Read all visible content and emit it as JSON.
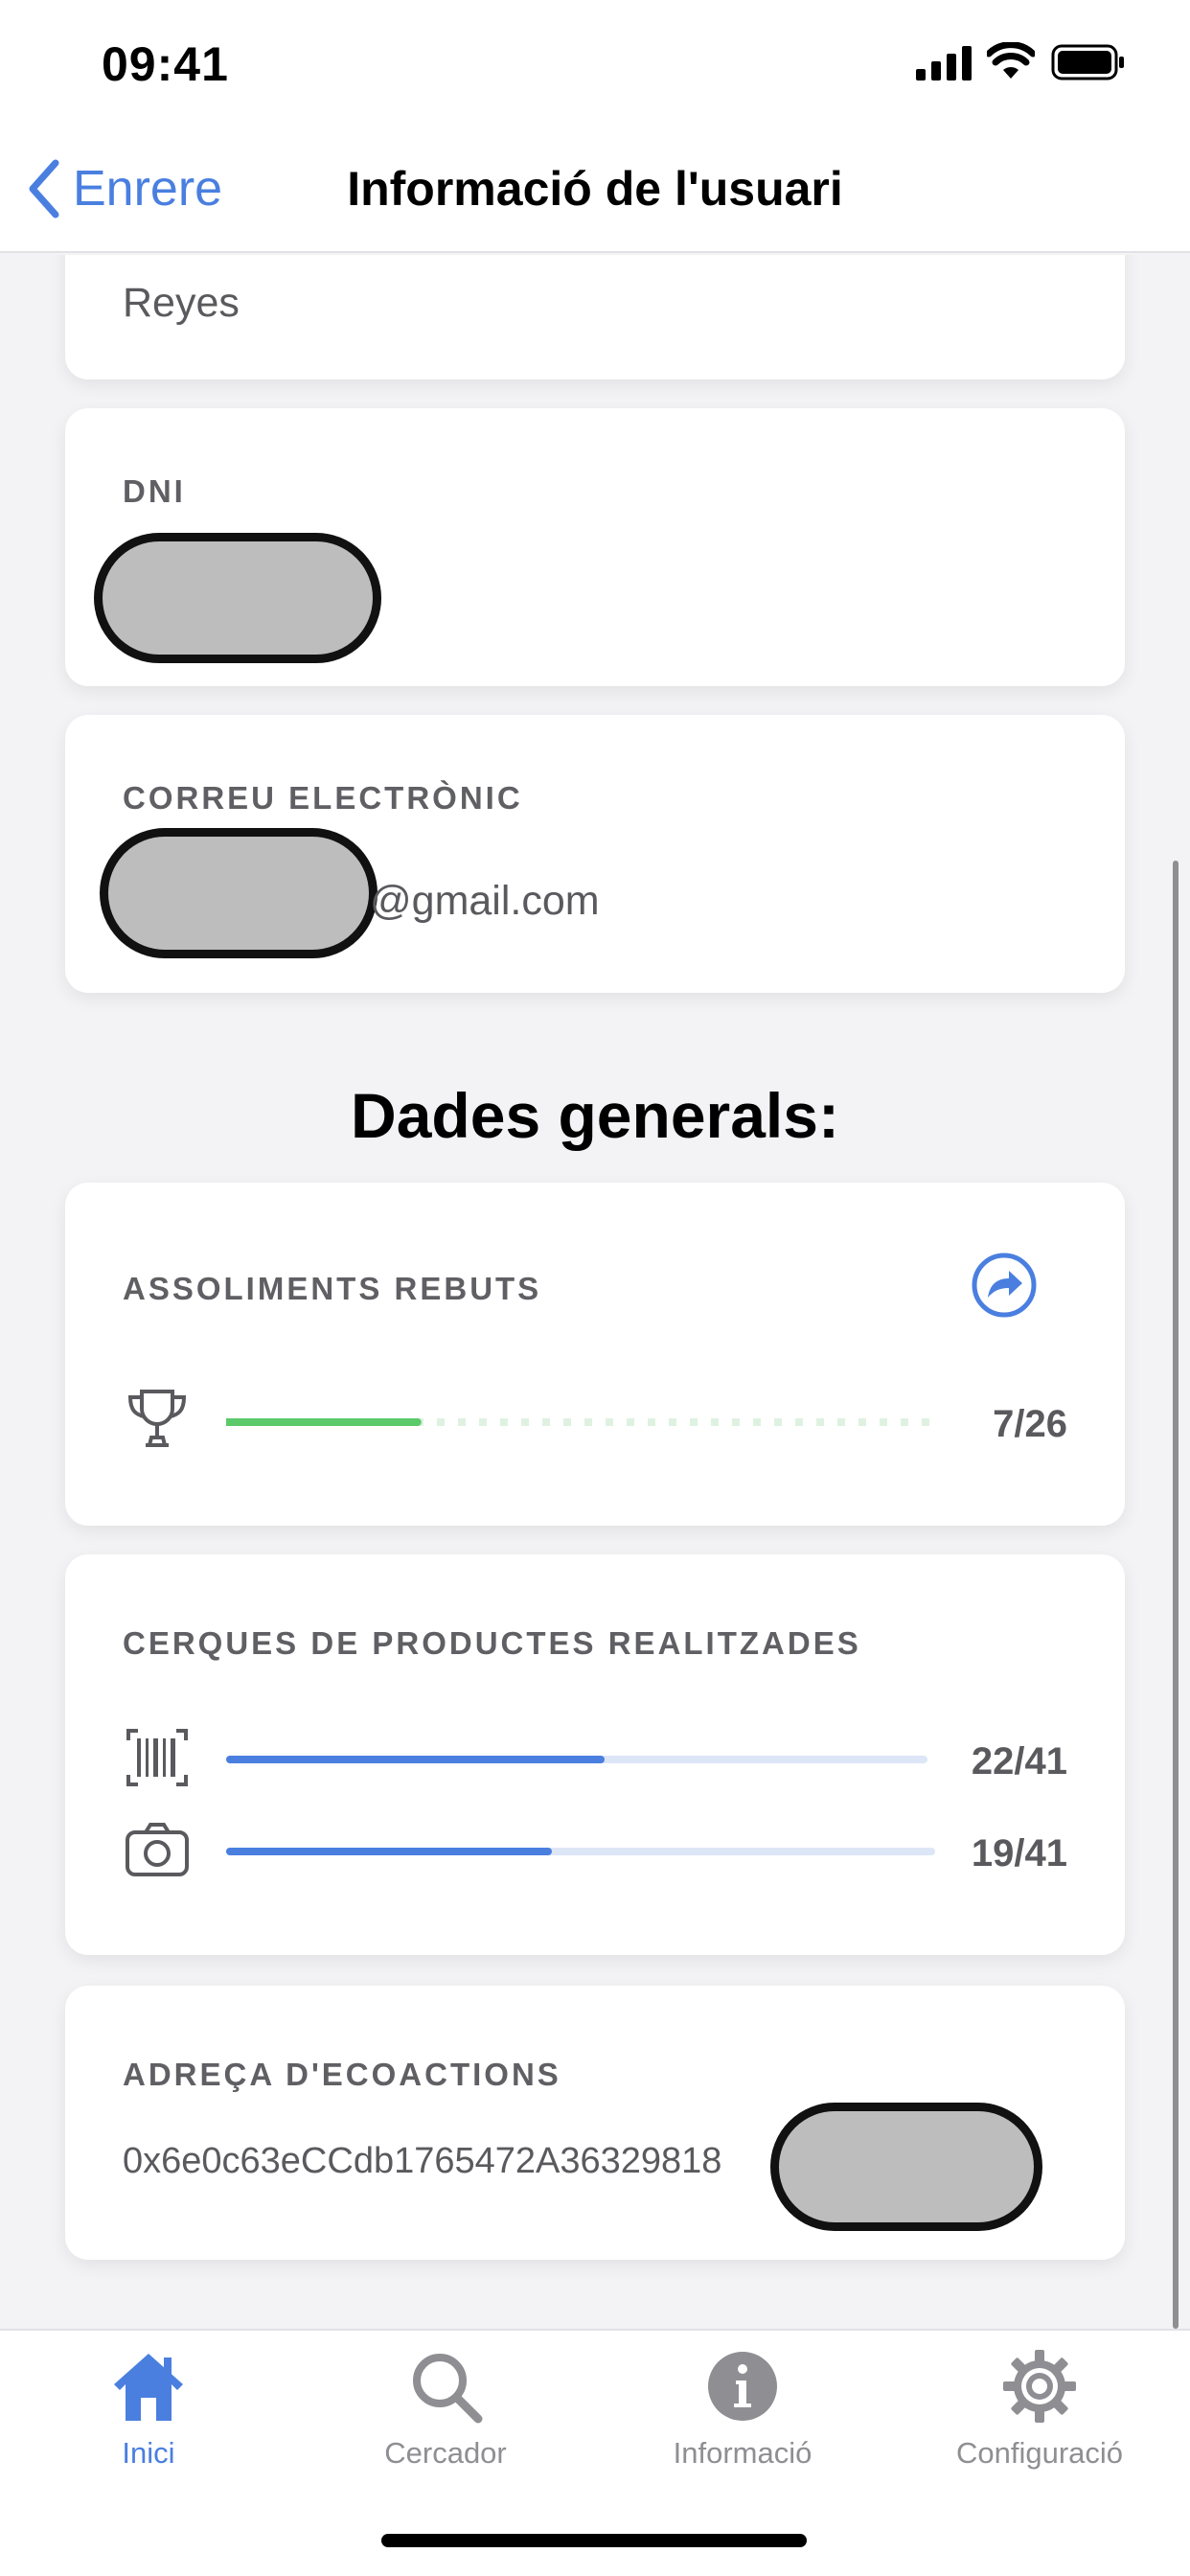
{
  "status_bar": {
    "time": "09:41"
  },
  "nav": {
    "back_label": "Enrere",
    "title": "Informació de l'usuari"
  },
  "fields": {
    "surname_value": "Reyes",
    "dni_label": "DNI",
    "email_label": "CORREU ELECTRÒNIC",
    "email_suffix": "@gmail.com"
  },
  "general": {
    "title": "Dades generals:",
    "achievements": {
      "label": "ASSOLIMENTS REBUTS",
      "count": "7/26",
      "progress": 0.27
    },
    "searches": {
      "label": "CERQUES DE PRODUCTES REALITZADES",
      "barcode_count": "22/41",
      "barcode_progress": 0.54,
      "camera_count": "19/41",
      "camera_progress": 0.46
    },
    "address": {
      "label": "ADREÇA D'ECOACTIONS",
      "value": "0x6e0c63eCCdb1765472A36329818"
    }
  },
  "tabs": [
    {
      "label": "Inici",
      "icon": "home-icon",
      "active": true
    },
    {
      "label": "Cercador",
      "icon": "search-icon",
      "active": false
    },
    {
      "label": "Informació",
      "icon": "info-icon",
      "active": false
    },
    {
      "label": "Configuració",
      "icon": "gear-icon",
      "active": false
    }
  ],
  "colors": {
    "accent": "#4a7fe0",
    "achievement_green": "#5cc96a",
    "bar_track": "#dce6f7"
  }
}
